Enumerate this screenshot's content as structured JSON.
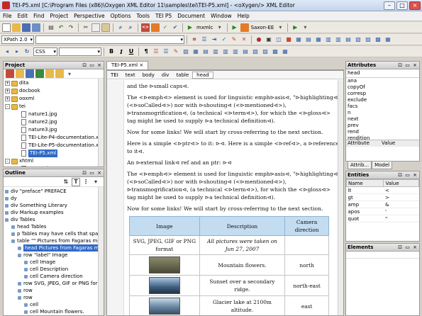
{
  "window": {
    "title": "TEI-P5.xml [C:\\Program Files (x86)\\Oxygen XML Editor 11\\samples\\tei\\TEI-P5.xml] - <oXygen/> XML Editor"
  },
  "menu": [
    "File",
    "Edit",
    "Find",
    "Project",
    "Perspective",
    "Options",
    "Tools",
    "TEI P5",
    "Document",
    "Window",
    "Help"
  ],
  "toolbar1": {
    "transform": "mxmlc",
    "validator": "Saxon-EE"
  },
  "toolbar2": {
    "xpath_label": "XPath 2.0",
    "css_label": "CSS"
  },
  "project": {
    "title": "Project",
    "items": [
      {
        "label": "dita",
        "type": "folder",
        "indent": 0,
        "toggle": "+"
      },
      {
        "label": "docbook",
        "type": "folder",
        "indent": 0,
        "toggle": "+"
      },
      {
        "label": "ooxml",
        "type": "folder",
        "indent": 0,
        "toggle": "+"
      },
      {
        "label": "tei",
        "type": "folder",
        "indent": 0,
        "toggle": "-"
      },
      {
        "label": "nature1.jpg",
        "type": "file",
        "indent": 1,
        "toggle": ""
      },
      {
        "label": "nature2.jpg",
        "type": "file",
        "indent": 1,
        "toggle": ""
      },
      {
        "label": "nature3.jpg",
        "type": "file",
        "indent": 1,
        "toggle": ""
      },
      {
        "label": "TEI-Lite-P4-documentation.xml",
        "type": "file",
        "indent": 1,
        "toggle": ""
      },
      {
        "label": "TEI-Lite-P5-documentation.xml",
        "type": "file",
        "indent": 1,
        "toggle": ""
      },
      {
        "label": "TEI-P5.xml",
        "type": "file",
        "indent": 1,
        "toggle": "",
        "selected": true
      },
      {
        "label": "xhtml",
        "type": "folder",
        "indent": 0,
        "toggle": "-"
      },
      {
        "label": "copy.xsl",
        "type": "file",
        "indent": 1,
        "toggle": ""
      }
    ]
  },
  "outline": {
    "title": "Outline",
    "items": [
      {
        "label": "div \"preface\" PREFACE",
        "indent": 0
      },
      {
        "label": "dy",
        "indent": 0
      },
      {
        "label": "div Something Literary",
        "indent": 0
      },
      {
        "label": "div Markup examples",
        "indent": 0
      },
      {
        "label": "div Tables",
        "indent": 0
      },
      {
        "label": "head Tables",
        "indent": 1
      },
      {
        "label": "p Tables may have cells that spa",
        "indent": 1
      },
      {
        "label": "table \"\" Pictures from Fagaras mountain",
        "indent": 1
      },
      {
        "label": "head Pictures from Fagaras mountain",
        "indent": 2,
        "selected": true
      },
      {
        "label": "row \"label\" Image",
        "indent": 2
      },
      {
        "label": "cell Image",
        "indent": 3
      },
      {
        "label": "cell Description",
        "indent": 3
      },
      {
        "label": "cell Camera direction",
        "indent": 3
      },
      {
        "label": "row SVG, JPEG, GIF or PNG format",
        "indent": 2
      },
      {
        "label": "row",
        "indent": 2
      },
      {
        "label": "row",
        "indent": 2
      },
      {
        "label": "cell",
        "indent": 3
      },
      {
        "label": "cell Mountain flowers.",
        "indent": 3
      }
    ]
  },
  "editor": {
    "tab": "TEI-P5.xml",
    "breadcrumb": [
      "TEI",
      "text",
      "body",
      "div",
      "table",
      "head"
    ],
    "p1": "and the ⊳small caps⊲.",
    "p2": "The <⊳emph⊲> element is used for linguistic emph⊳asis⊲, \"⊳highlighting⊲\" (<⊳soCalled⊲>) nor with ⊳shouting⊲ (<⊳mentioned⊲>), ⊳transmogrification⊲, (a technical <⊳term⊲>), for which the <⊳gloss⊲> tag might be used to supply ⊳a technical definition⊲).",
    "p3": "Now for some links! We will start by cross-referring to the next section.",
    "p4": "Here is a simple <⊳ptr⊲> to it: ⊳⊲. Here is a simple <⊳ref⊲>, a ⊳reference to it⊲.",
    "p5": "An ⊳external link⊲ ref and an ptr: ⊳⊲",
    "p6": "The <⊳emph⊲> element is used for linguistic emph⊳asis⊲, \"⊳highlighting⊲\" (<⊳soCalled⊲>) nor with ⊳shouting⊲ (<⊳mentioned⊲>), ⊳transmogrification⊲, (a technical <⊳term⊲>), for which the <⊳gloss⊲> tag might be used to supply ⊳a technical definition⊲).",
    "p7": "Now for some links! We will start by cross-referring to the next section.",
    "table": {
      "headers": [
        "Image",
        "Description",
        "Camera direction"
      ],
      "format_row": [
        "SVG, JPEG, GIF or PNG format",
        "All pictures were taken on Jun 27, 2007",
        ""
      ],
      "rows": [
        {
          "desc": "Mountain flowers.",
          "dir": "north",
          "color": "#6b6b52"
        },
        {
          "desc": "Sunset over a secondary ridge.",
          "dir": "north-east",
          "color": "#4f6f8f"
        },
        {
          "desc": "Glacier lake at 2100m altitude.",
          "dir": "east",
          "color": "#5e7a94"
        }
      ]
    }
  },
  "attributes": {
    "title": "Attributes",
    "element": "head",
    "list": [
      "ana",
      "copyOf",
      "corresp",
      "exclude",
      "facs",
      "n",
      "next",
      "prev",
      "rend",
      "rendition"
    ],
    "col_attr": "Attribute",
    "col_val": "Value",
    "tabs": [
      "Attrib...",
      "Model"
    ]
  },
  "entities": {
    "title": "Entities",
    "col_name": "Name",
    "col_val": "Value",
    "rows": [
      [
        "lt",
        "<"
      ],
      [
        "gt",
        ">"
      ],
      [
        "amp",
        "&"
      ],
      [
        "apos",
        "'"
      ],
      [
        "quot",
        "\""
      ]
    ]
  },
  "elements": {
    "title": "Elements"
  }
}
